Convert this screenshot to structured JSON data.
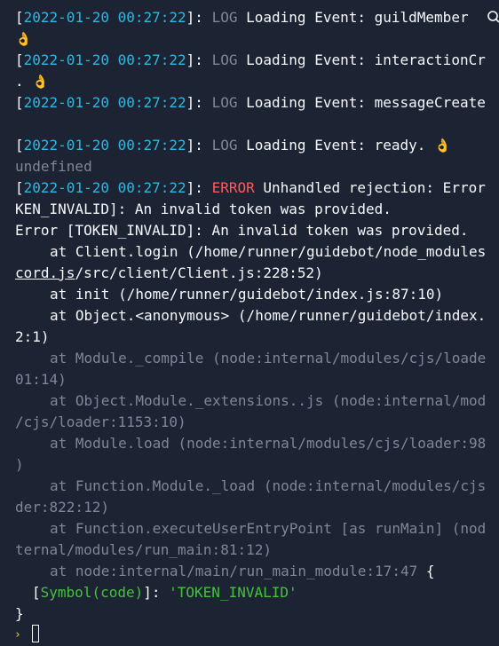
{
  "console": {
    "ok_emoji": "👌",
    "log1": {
      "timestamp": "2022-01-20 00:27:22",
      "level": "LOG",
      "message": "Loading Event: guildMember"
    },
    "log2": {
      "timestamp": "2022-01-20 00:27:22",
      "level": "LOG",
      "message": "Loading Event: interactionCr",
      "wrap": "."
    },
    "log3": {
      "timestamp": "2022-01-20 00:27:22",
      "level": "LOG",
      "message": "Loading Event: messageCreate"
    },
    "log4": {
      "timestamp": "2022-01-20 00:27:22",
      "level": "LOG",
      "message": "Loading Event: ready."
    },
    "undefined_line": "undefined",
    "error": {
      "timestamp": "2022-01-20 00:27:22",
      "level": "ERROR",
      "message": "Unhandled rejection: Error",
      "cont": "KEN_INVALID]: An invalid token was provided.",
      "line2": "Error [TOKEN_INVALID]: An invalid token was provided."
    },
    "stack": {
      "s1": "at Client.login (/home/runner/guidebot/node_modules",
      "s1_link": "cord.js",
      "s1_rest": "/src/client/Client.js:228:52)",
      "s2": "at init (/home/runner/guidebot/index.js:87:10)",
      "s3": "at Object.<anonymous> (/home/runner/guidebot/index.",
      "s3_cont": "2:1)",
      "s4": "at Module._compile (node:internal/modules/cjs/loade",
      "s4_cont": "01:14)",
      "s5": "at Object.Module._extensions..js (node:internal/mod",
      "s5_cont": "/cjs/loader:1153:10)",
      "s6": "at Module.load (node:internal/modules/cjs/loader:98",
      "s6_cont": ")",
      "s7": "at Function.Module._load (node:internal/modules/cjs",
      "s7_cont": "der:822:12)",
      "s8": "at Function.executeUserEntryPoint [as runMain] (nod",
      "s8_cont": "ternal/modules/run_main:81:12)",
      "s9": "at node:internal/main/run_main_module:17:47",
      "s9_brace": "{"
    },
    "symbol": {
      "open": "[",
      "name": "Symbol(code)",
      "close": "]:",
      "value": "'TOKEN_INVALID'"
    },
    "closing_brace": "}",
    "prompt_symbol": "›"
  },
  "colors": {
    "background": "#1c2333",
    "text": "#f5f9fc",
    "muted": "#7d8799",
    "timestamp": "#2eb6e4",
    "error": "#ff5a5a",
    "symbol": "#46c13e",
    "string": "#46c13e",
    "prompt": "#f2c94c"
  }
}
